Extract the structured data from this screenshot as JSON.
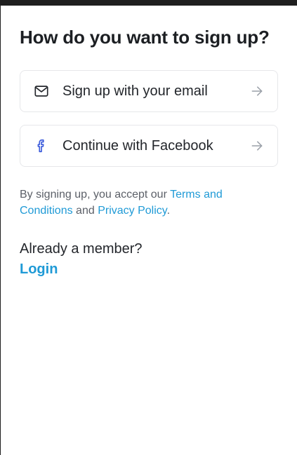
{
  "page": {
    "title": "How do you want to sign up?"
  },
  "options": {
    "email_label": "Sign up with your email",
    "facebook_label": "Continue with Facebook"
  },
  "legal": {
    "prefix": "By signing up, you accept our ",
    "terms_link": "Terms and Conditions",
    "middle": " and ",
    "privacy_link": "Privacy Policy",
    "suffix": "."
  },
  "member": {
    "prompt": "Already a member?",
    "login_label": "Login"
  },
  "colors": {
    "accent": "#1f9ad6",
    "facebook": "#3b5bdb",
    "border": "#e6e7ea"
  },
  "icons": {
    "email": "mail-icon",
    "facebook": "facebook-icon",
    "arrow": "arrow-right-icon"
  }
}
